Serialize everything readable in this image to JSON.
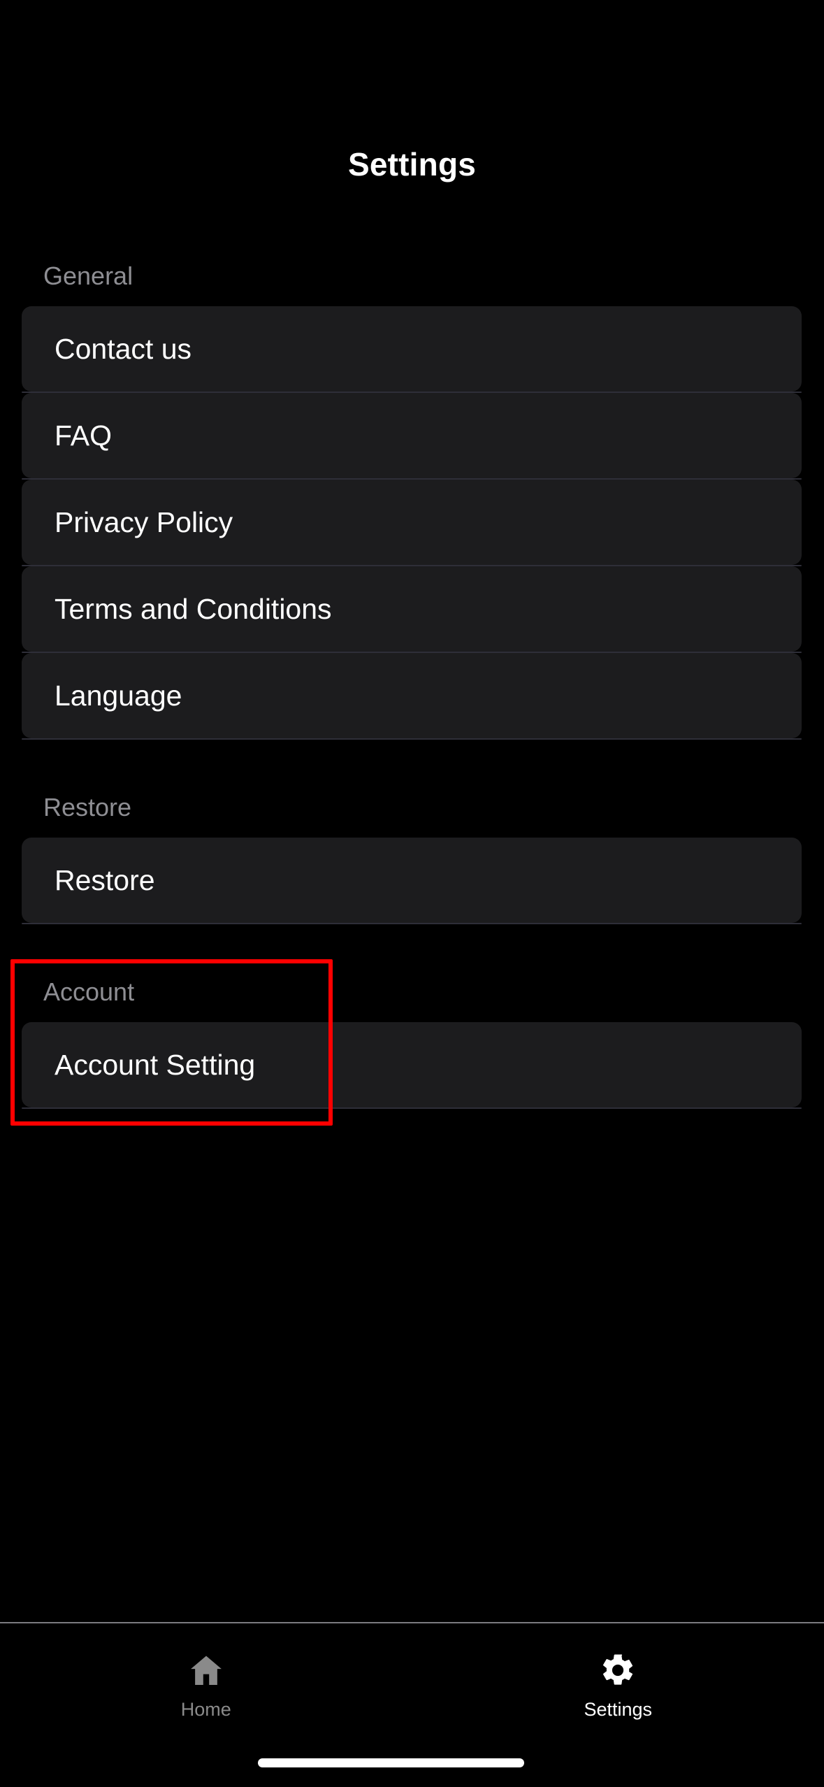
{
  "header": {
    "title": "Settings"
  },
  "theme": {
    "background": "#000000",
    "row_background": "#1c1c1e",
    "row_separator": "#2e2e38",
    "primary_text": "#ffffff",
    "secondary_text": "#8e8e93",
    "highlight_border": "#ff0000",
    "tab_inactive": "#8a8a8a",
    "tab_active": "#ffffff"
  },
  "sections": [
    {
      "key": "general",
      "header": "General",
      "rows": [
        {
          "label": "Contact us"
        },
        {
          "label": "FAQ"
        },
        {
          "label": "Privacy Policy"
        },
        {
          "label": "Terms and Conditions"
        },
        {
          "label": "Language"
        }
      ]
    },
    {
      "key": "restore",
      "header": "Restore",
      "rows": [
        {
          "label": "Restore"
        }
      ]
    },
    {
      "key": "account",
      "header": "Account",
      "rows": [
        {
          "label": "Account Setting"
        }
      ]
    }
  ],
  "tabbar": {
    "items": [
      {
        "label": "Home",
        "icon": "home-icon",
        "active": false
      },
      {
        "label": "Settings",
        "icon": "gear-icon",
        "active": true
      }
    ]
  }
}
